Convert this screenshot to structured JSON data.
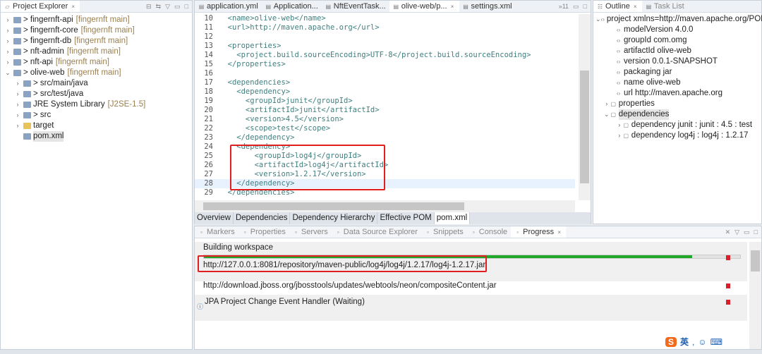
{
  "explorer": {
    "title": "Project Explorer",
    "items": [
      {
        "label": "> fingernft-api",
        "tag": "[fingernft main]"
      },
      {
        "label": "> fingernft-core",
        "tag": "[fingernft main]"
      },
      {
        "label": "> fingernft-db",
        "tag": "[fingernft main]"
      },
      {
        "label": "> nft-admin",
        "tag": "[fingernft main]"
      },
      {
        "label": "> nft-api",
        "tag": "[fingernft main]"
      },
      {
        "label": "> olive-web",
        "tag": "[fingernft main]"
      },
      {
        "label": "> src/main/java",
        "tag": ""
      },
      {
        "label": "> src/test/java",
        "tag": ""
      },
      {
        "label": "JRE System Library",
        "tag": "[J2SE-1.5]"
      },
      {
        "label": "> src",
        "tag": ""
      },
      {
        "label": "target",
        "tag": ""
      },
      {
        "label": "pom.xml",
        "tag": ""
      }
    ]
  },
  "editor": {
    "tabs": [
      "application.yml",
      "Application...",
      "NftEventTask...",
      "olive-web/p...",
      "settings.xml"
    ],
    "overflow": "»11",
    "lines": [
      {
        "n": "10",
        "t": "  <name>olive-web</name>"
      },
      {
        "n": "11",
        "t": "  <url>http://maven.apache.org</url>"
      },
      {
        "n": "12",
        "t": ""
      },
      {
        "n": "13",
        "t": "  <properties>"
      },
      {
        "n": "14",
        "t": "    <project.build.sourceEncoding>UTF-8</project.build.sourceEncoding>"
      },
      {
        "n": "15",
        "t": "  </properties>"
      },
      {
        "n": "16",
        "t": ""
      },
      {
        "n": "17",
        "t": "  <dependencies>"
      },
      {
        "n": "18",
        "t": "    <dependency>"
      },
      {
        "n": "19",
        "t": "      <groupId>junit</groupId>"
      },
      {
        "n": "20",
        "t": "      <artifactId>junit</artifactId>"
      },
      {
        "n": "21",
        "t": "      <version>4.5</version>"
      },
      {
        "n": "22",
        "t": "      <scope>test</scope>"
      },
      {
        "n": "23",
        "t": "    </dependency>"
      },
      {
        "n": "24",
        "t": "    <dependency>"
      },
      {
        "n": "25",
        "t": "        <groupId>log4j</groupId>"
      },
      {
        "n": "26",
        "t": "        <artifactId>log4j</artifactId>"
      },
      {
        "n": "27",
        "t": "        <version>1.2.17</version>"
      },
      {
        "n": "28",
        "t": "    </dependency>"
      },
      {
        "n": "29",
        "t": "  </dependencies>"
      }
    ],
    "subtabs": [
      "Overview",
      "Dependencies",
      "Dependency Hierarchy",
      "Effective POM",
      "pom.xml"
    ]
  },
  "outline": {
    "tabs": [
      "Outline",
      "Task List"
    ],
    "items": [
      "project xmlns=http://maven.apache.org/POM",
      "modelVersion  4.0.0",
      "groupId  com.omg",
      "artifactId  olive-web",
      "version  0.0.1-SNAPSHOT",
      "packaging  jar",
      "name  olive-web",
      "url  http://maven.apache.org",
      "properties",
      "dependencies",
      "dependency  junit : junit : 4.5 : test",
      "dependency  log4j : log4j : 1.2.17"
    ]
  },
  "bottom": {
    "tabs": [
      "Markers",
      "Properties",
      "Servers",
      "Data Source Explorer",
      "Snippets",
      "Console",
      "Progress"
    ],
    "jobs": [
      {
        "title": "Building workspace",
        "progress": 0.91,
        "detail": "http://127.0.0.1:8081/repository/maven-public/log4j/log4j/1.2.17/log4j-1.2.17.jar"
      },
      {
        "title": "http://download.jboss.org/jbosstools/updates/webtools/neon/compositeContent.jar"
      },
      {
        "title": "JPA Project Change Event Handler (Waiting)"
      }
    ]
  },
  "ime": {
    "lang": "英"
  },
  "colors": {
    "highlight": "#e02020",
    "progress": "#1fa82a"
  }
}
